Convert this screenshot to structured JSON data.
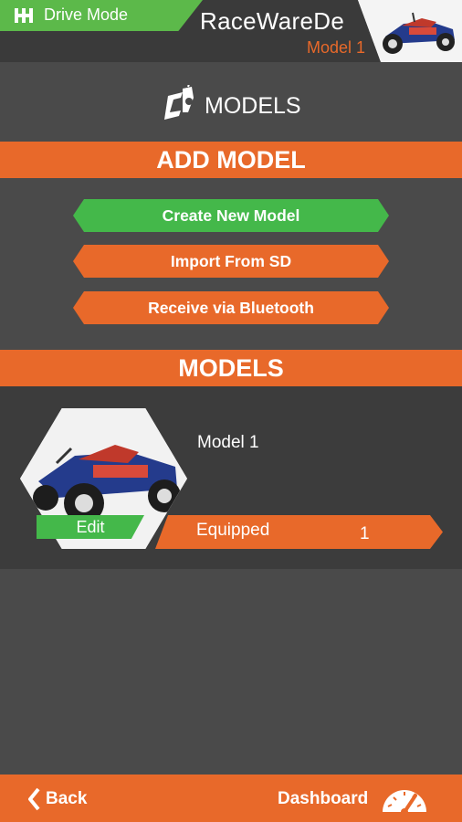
{
  "header": {
    "drive_mode_label": "Drive Mode",
    "app_title": "RaceWareDe",
    "current_model": "Model 1"
  },
  "page": {
    "title": "MODELS"
  },
  "add_model": {
    "heading": "ADD MODEL",
    "create_label": "Create New Model",
    "import_label": "Import From SD",
    "bluetooth_label": "Receive via Bluetooth"
  },
  "models_section": {
    "heading": "MODELS",
    "items": [
      {
        "name": "Model 1",
        "edit_label": "Edit",
        "status_label": "Equipped",
        "status_value": "1"
      }
    ]
  },
  "footer": {
    "back_label": "Back",
    "dashboard_label": "Dashboard"
  },
  "colors": {
    "accent": "#e8692a",
    "green": "#44b84a",
    "drive_mode_green": "#5cb94a",
    "background": "#4a4a4a"
  },
  "icons": {
    "drive_mode": "gear-shift-icon",
    "models": "transmitter-icon",
    "back": "chevron-left-icon",
    "dashboard": "speedometer-icon"
  }
}
